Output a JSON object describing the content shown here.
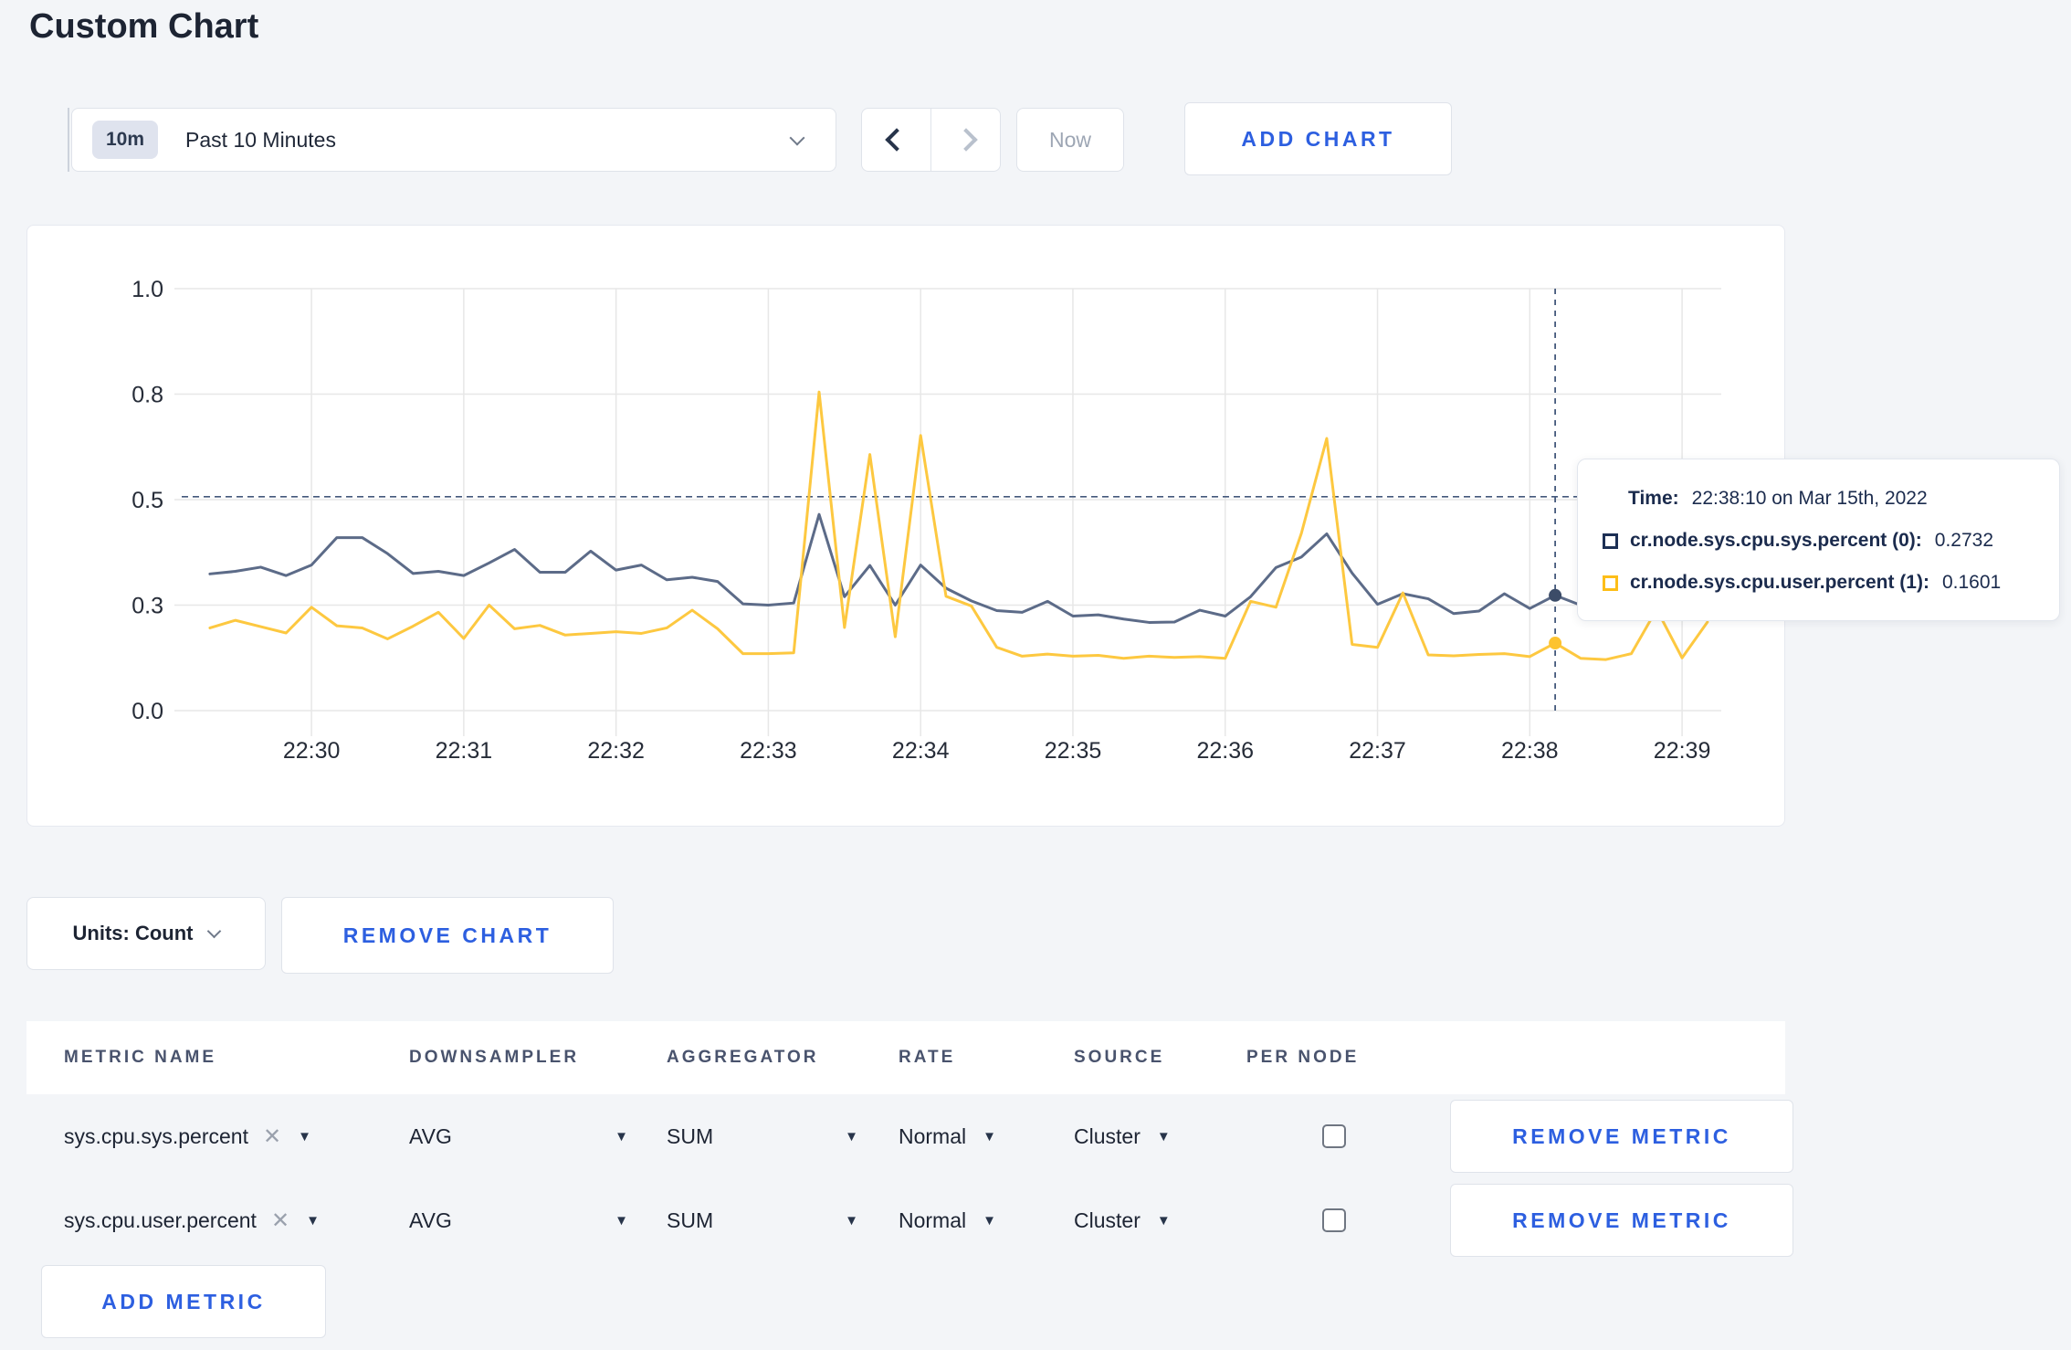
{
  "page": {
    "title": "Custom Chart"
  },
  "toolbar": {
    "time_range": {
      "badge": "10m",
      "label": "Past 10 Minutes"
    },
    "now_label": "Now",
    "add_chart_label": "ADD CHART"
  },
  "icons": {
    "caret_down": "▼",
    "clear": "✕"
  },
  "chart_data": {
    "type": "line",
    "x_axis": {
      "range": [
        "22:29:06",
        "22:39:14"
      ],
      "ticks": [
        "22:30",
        "22:31",
        "22:32",
        "22:33",
        "22:34",
        "22:35",
        "22:36",
        "22:37",
        "22:38",
        "22:39"
      ]
    },
    "y_axis": {
      "range": [
        0,
        1
      ],
      "ticks": [
        {
          "value": 0,
          "label": "0.0"
        },
        {
          "value": 0.25,
          "label": "0.3"
        },
        {
          "value": 0.5,
          "label": "0.5"
        },
        {
          "value": 0.75,
          "label": "0.8"
        },
        {
          "value": 1,
          "label": "1.0"
        }
      ]
    },
    "grid": true,
    "guide_line_value": 0.507,
    "crosshair": {
      "time": "22:38:10",
      "values": [
        0.2732,
        0.1601
      ]
    },
    "series": [
      {
        "name": "cr.node.sys.cpu.sys.percent (0)",
        "color": "#5c6b88",
        "start": "22:29:20",
        "step_seconds": 10,
        "values": [
          0.324,
          0.33,
          0.34,
          0.32,
          0.345,
          0.41,
          0.41,
          0.372,
          0.325,
          0.33,
          0.32,
          0.35,
          0.382,
          0.328,
          0.328,
          0.378,
          0.333,
          0.345,
          0.31,
          0.316,
          0.306,
          0.253,
          0.25,
          0.255,
          0.465,
          0.27,
          0.344,
          0.25,
          0.345,
          0.29,
          0.26,
          0.237,
          0.233,
          0.259,
          0.224,
          0.227,
          0.217,
          0.209,
          0.21,
          0.238,
          0.224,
          0.27,
          0.339,
          0.364,
          0.419,
          0.326,
          0.252,
          0.277,
          0.265,
          0.23,
          0.236,
          0.277,
          0.242,
          0.2732,
          0.25,
          0.258,
          0.268,
          0.28,
          0.292,
          0.303
        ]
      },
      {
        "name": "cr.node.sys.cpu.user.percent (1)",
        "color": "#fdc840",
        "start": "22:29:20",
        "step_seconds": 10,
        "values": [
          0.196,
          0.214,
          0.199,
          0.184,
          0.245,
          0.201,
          0.196,
          0.17,
          0.2,
          0.233,
          0.171,
          0.25,
          0.194,
          0.202,
          0.179,
          0.183,
          0.187,
          0.183,
          0.196,
          0.238,
          0.194,
          0.135,
          0.135,
          0.137,
          0.755,
          0.197,
          0.607,
          0.175,
          0.652,
          0.271,
          0.248,
          0.15,
          0.129,
          0.134,
          0.129,
          0.131,
          0.124,
          0.129,
          0.126,
          0.128,
          0.124,
          0.259,
          0.245,
          0.42,
          0.645,
          0.157,
          0.15,
          0.279,
          0.132,
          0.13,
          0.133,
          0.135,
          0.128,
          0.1601,
          0.124,
          0.121,
          0.135,
          0.24,
          0.125,
          0.21
        ]
      }
    ]
  },
  "tooltip": {
    "time_label": "Time:",
    "time_value": "22:38:10 on Mar 15th, 2022",
    "rows": [
      {
        "label": "cr.node.sys.cpu.sys.percent (0):",
        "value": "0.2732",
        "color": "#1c2f54"
      },
      {
        "label": "cr.node.sys.cpu.user.percent (1):",
        "value": "0.1601",
        "color": "#fdbe18"
      }
    ]
  },
  "chart_controls": {
    "units_label": "Units: Count",
    "remove_chart_label": "REMOVE CHART"
  },
  "metrics_table": {
    "headers": [
      "METRIC NAME",
      "DOWNSAMPLER",
      "AGGREGATOR",
      "RATE",
      "SOURCE",
      "PER NODE"
    ],
    "rows": [
      {
        "metric_name": "sys.cpu.sys.percent",
        "downsampler": "AVG",
        "aggregator": "SUM",
        "rate": "Normal",
        "source": "Cluster",
        "per_node": false,
        "remove_label": "REMOVE METRIC"
      },
      {
        "metric_name": "sys.cpu.user.percent",
        "downsampler": "AVG",
        "aggregator": "SUM",
        "rate": "Normal",
        "source": "Cluster",
        "per_node": false,
        "remove_label": "REMOVE METRIC"
      }
    ],
    "add_metric_label": "ADD METRIC"
  }
}
